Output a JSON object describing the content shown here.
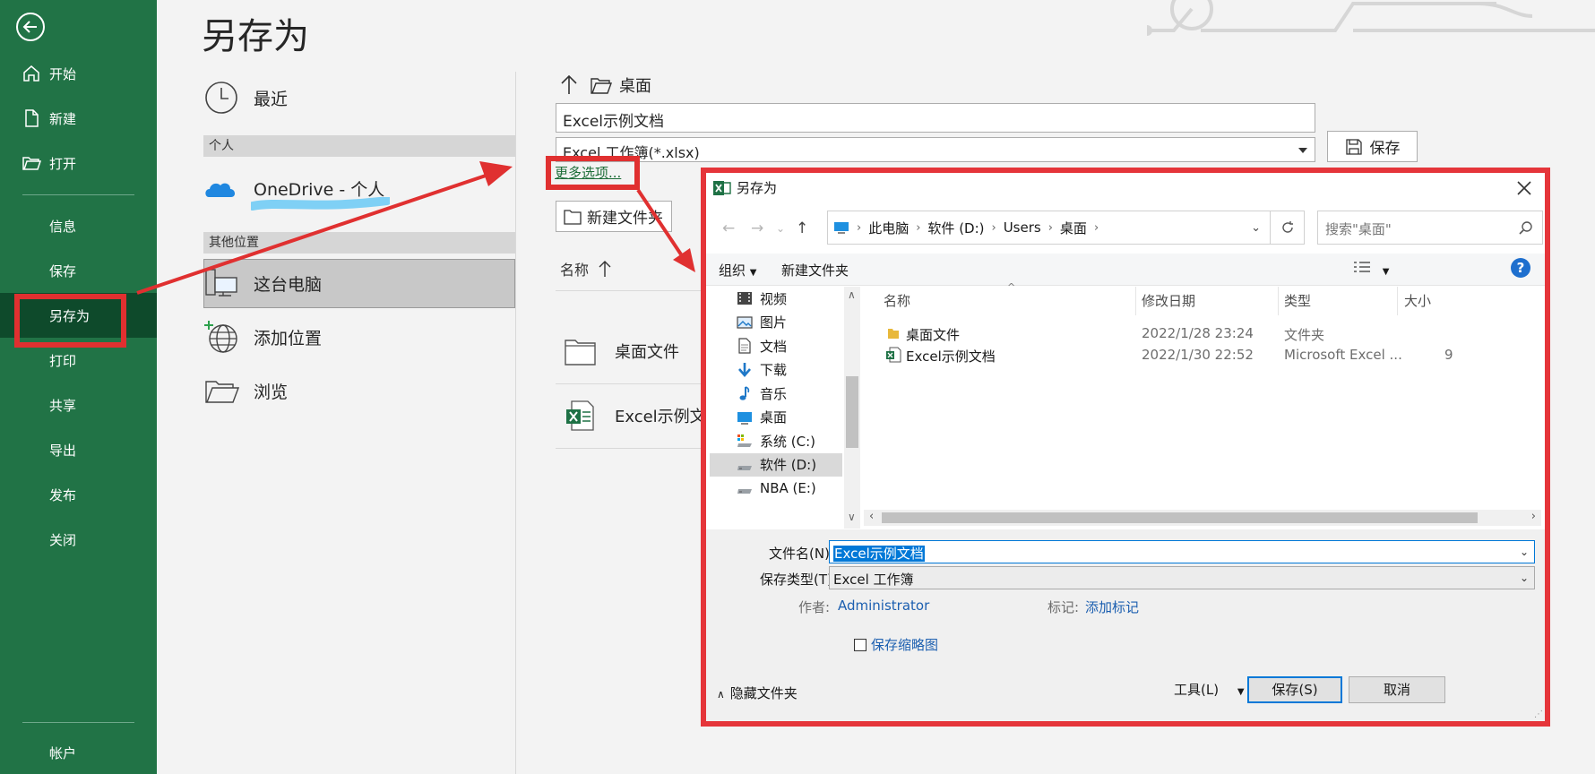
{
  "sidebar": {
    "items": [
      {
        "label": "开始"
      },
      {
        "label": "新建"
      },
      {
        "label": "打开"
      },
      {
        "label": "信息"
      },
      {
        "label": "保存"
      },
      {
        "label": "另存为"
      },
      {
        "label": "打印"
      },
      {
        "label": "共享"
      },
      {
        "label": "导出"
      },
      {
        "label": "发布"
      },
      {
        "label": "关闭"
      }
    ],
    "account": "帐户",
    "active_item": "另存为",
    "bg_color": "#217346",
    "active_color": "#0e4a2b"
  },
  "page": {
    "title": "另存为"
  },
  "locations": {
    "recent": "最近",
    "personal_header": "个人",
    "onedrive": "OneDrive - 个人",
    "other_header": "其他位置",
    "this_pc": "这台电脑",
    "add_place": "添加位置",
    "browse": "浏览"
  },
  "save_pane": {
    "current_folder": "桌面",
    "filename": "Excel示例文档",
    "filetype": "Excel 工作簿(*.xlsx)",
    "save_button": "保存",
    "more_options": "更多选项...",
    "new_folder": "新建文件夹",
    "column_name": "名称",
    "files": [
      {
        "name": "桌面文件",
        "icon": "folder-icon"
      },
      {
        "name": "Excel示例文档",
        "icon": "excel-file-icon"
      }
    ]
  },
  "dialog": {
    "title": "另存为",
    "breadcrumb": [
      "此电脑",
      "软件 (D:)",
      "Users",
      "桌面"
    ],
    "search_placeholder": "搜索\"桌面\"",
    "toolbar": {
      "organize": "组织",
      "new_folder": "新建文件夹"
    },
    "tree": [
      {
        "label": "视频",
        "icon": "video-icon"
      },
      {
        "label": "图片",
        "icon": "picture-icon"
      },
      {
        "label": "文档",
        "icon": "document-icon"
      },
      {
        "label": "下载",
        "icon": "download-icon"
      },
      {
        "label": "音乐",
        "icon": "music-icon"
      },
      {
        "label": "桌面",
        "icon": "desktop-icon"
      },
      {
        "label": "系统 (C:)",
        "icon": "system-drive-icon"
      },
      {
        "label": "软件 (D:)",
        "icon": "drive-icon",
        "selected": true
      },
      {
        "label": "NBA (E:)",
        "icon": "drive-icon"
      }
    ],
    "columns": {
      "name": "名称",
      "modified": "修改日期",
      "type": "类型",
      "size": "大小"
    },
    "files": [
      {
        "name": "桌面文件",
        "modified": "2022/1/28 23:24",
        "type": "文件夹",
        "size": "",
        "icon": "folder-icon"
      },
      {
        "name": "Excel示例文档",
        "modified": "2022/1/30 22:52",
        "type": "Microsoft Excel ...",
        "size": "9",
        "icon": "excel-file-icon"
      }
    ],
    "filename_label": "文件名(N):",
    "filename_value": "Excel示例文档",
    "filetype_label": "保存类型(T):",
    "filetype_value": "Excel 工作簿",
    "author_label": "作者:",
    "author_value": "Administrator",
    "tags_label": "标记:",
    "tags_value": "添加标记",
    "thumbnail_label": "保存缩略图",
    "thumbnail_checked": false,
    "hide_folders": "隐藏文件夹",
    "tools": "工具(L)",
    "save": "保存(S)",
    "cancel": "取消",
    "highlight_color": "#e5353a"
  }
}
